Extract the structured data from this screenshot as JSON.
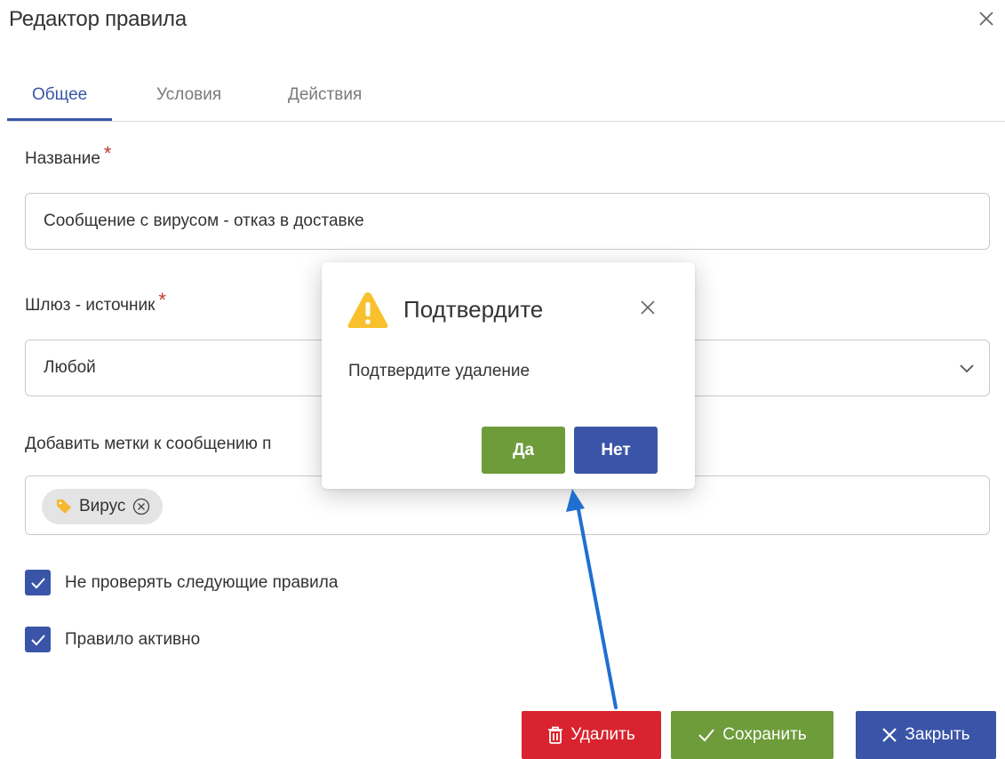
{
  "window": {
    "title": "Редактор правила"
  },
  "tabs": [
    {
      "label": "Общее",
      "active": true
    },
    {
      "label": "Условия",
      "active": false
    },
    {
      "label": "Действия",
      "active": false
    }
  ],
  "form": {
    "name_label": "Название",
    "name_value": "Сообщение с вирусом - отказ в доставке",
    "gateway_label": "Шлюз - источник",
    "gateway_value": "Любой",
    "tags_label": "Добавить метки к сообщению п",
    "tags": [
      {
        "label": "Вирус",
        "icon": "tag-icon"
      }
    ],
    "required_mark": "*",
    "checkboxes": [
      {
        "label": "Не проверять следующие правила",
        "checked": true
      },
      {
        "label": "Правило активно",
        "checked": true
      }
    ]
  },
  "footer": {
    "delete_label": "Удалить",
    "save_label": "Сохранить",
    "close_label": "Закрыть"
  },
  "dialog": {
    "title": "Подтвердите",
    "message": "Подтвердите удаление",
    "yes_label": "Да",
    "no_label": "Нет"
  },
  "colors": {
    "primary": "#3a55a8",
    "success": "#6e9c3b",
    "danger": "#d9232e",
    "warning": "#f7c02c",
    "annotation_arrow": "#1f6fd0"
  }
}
